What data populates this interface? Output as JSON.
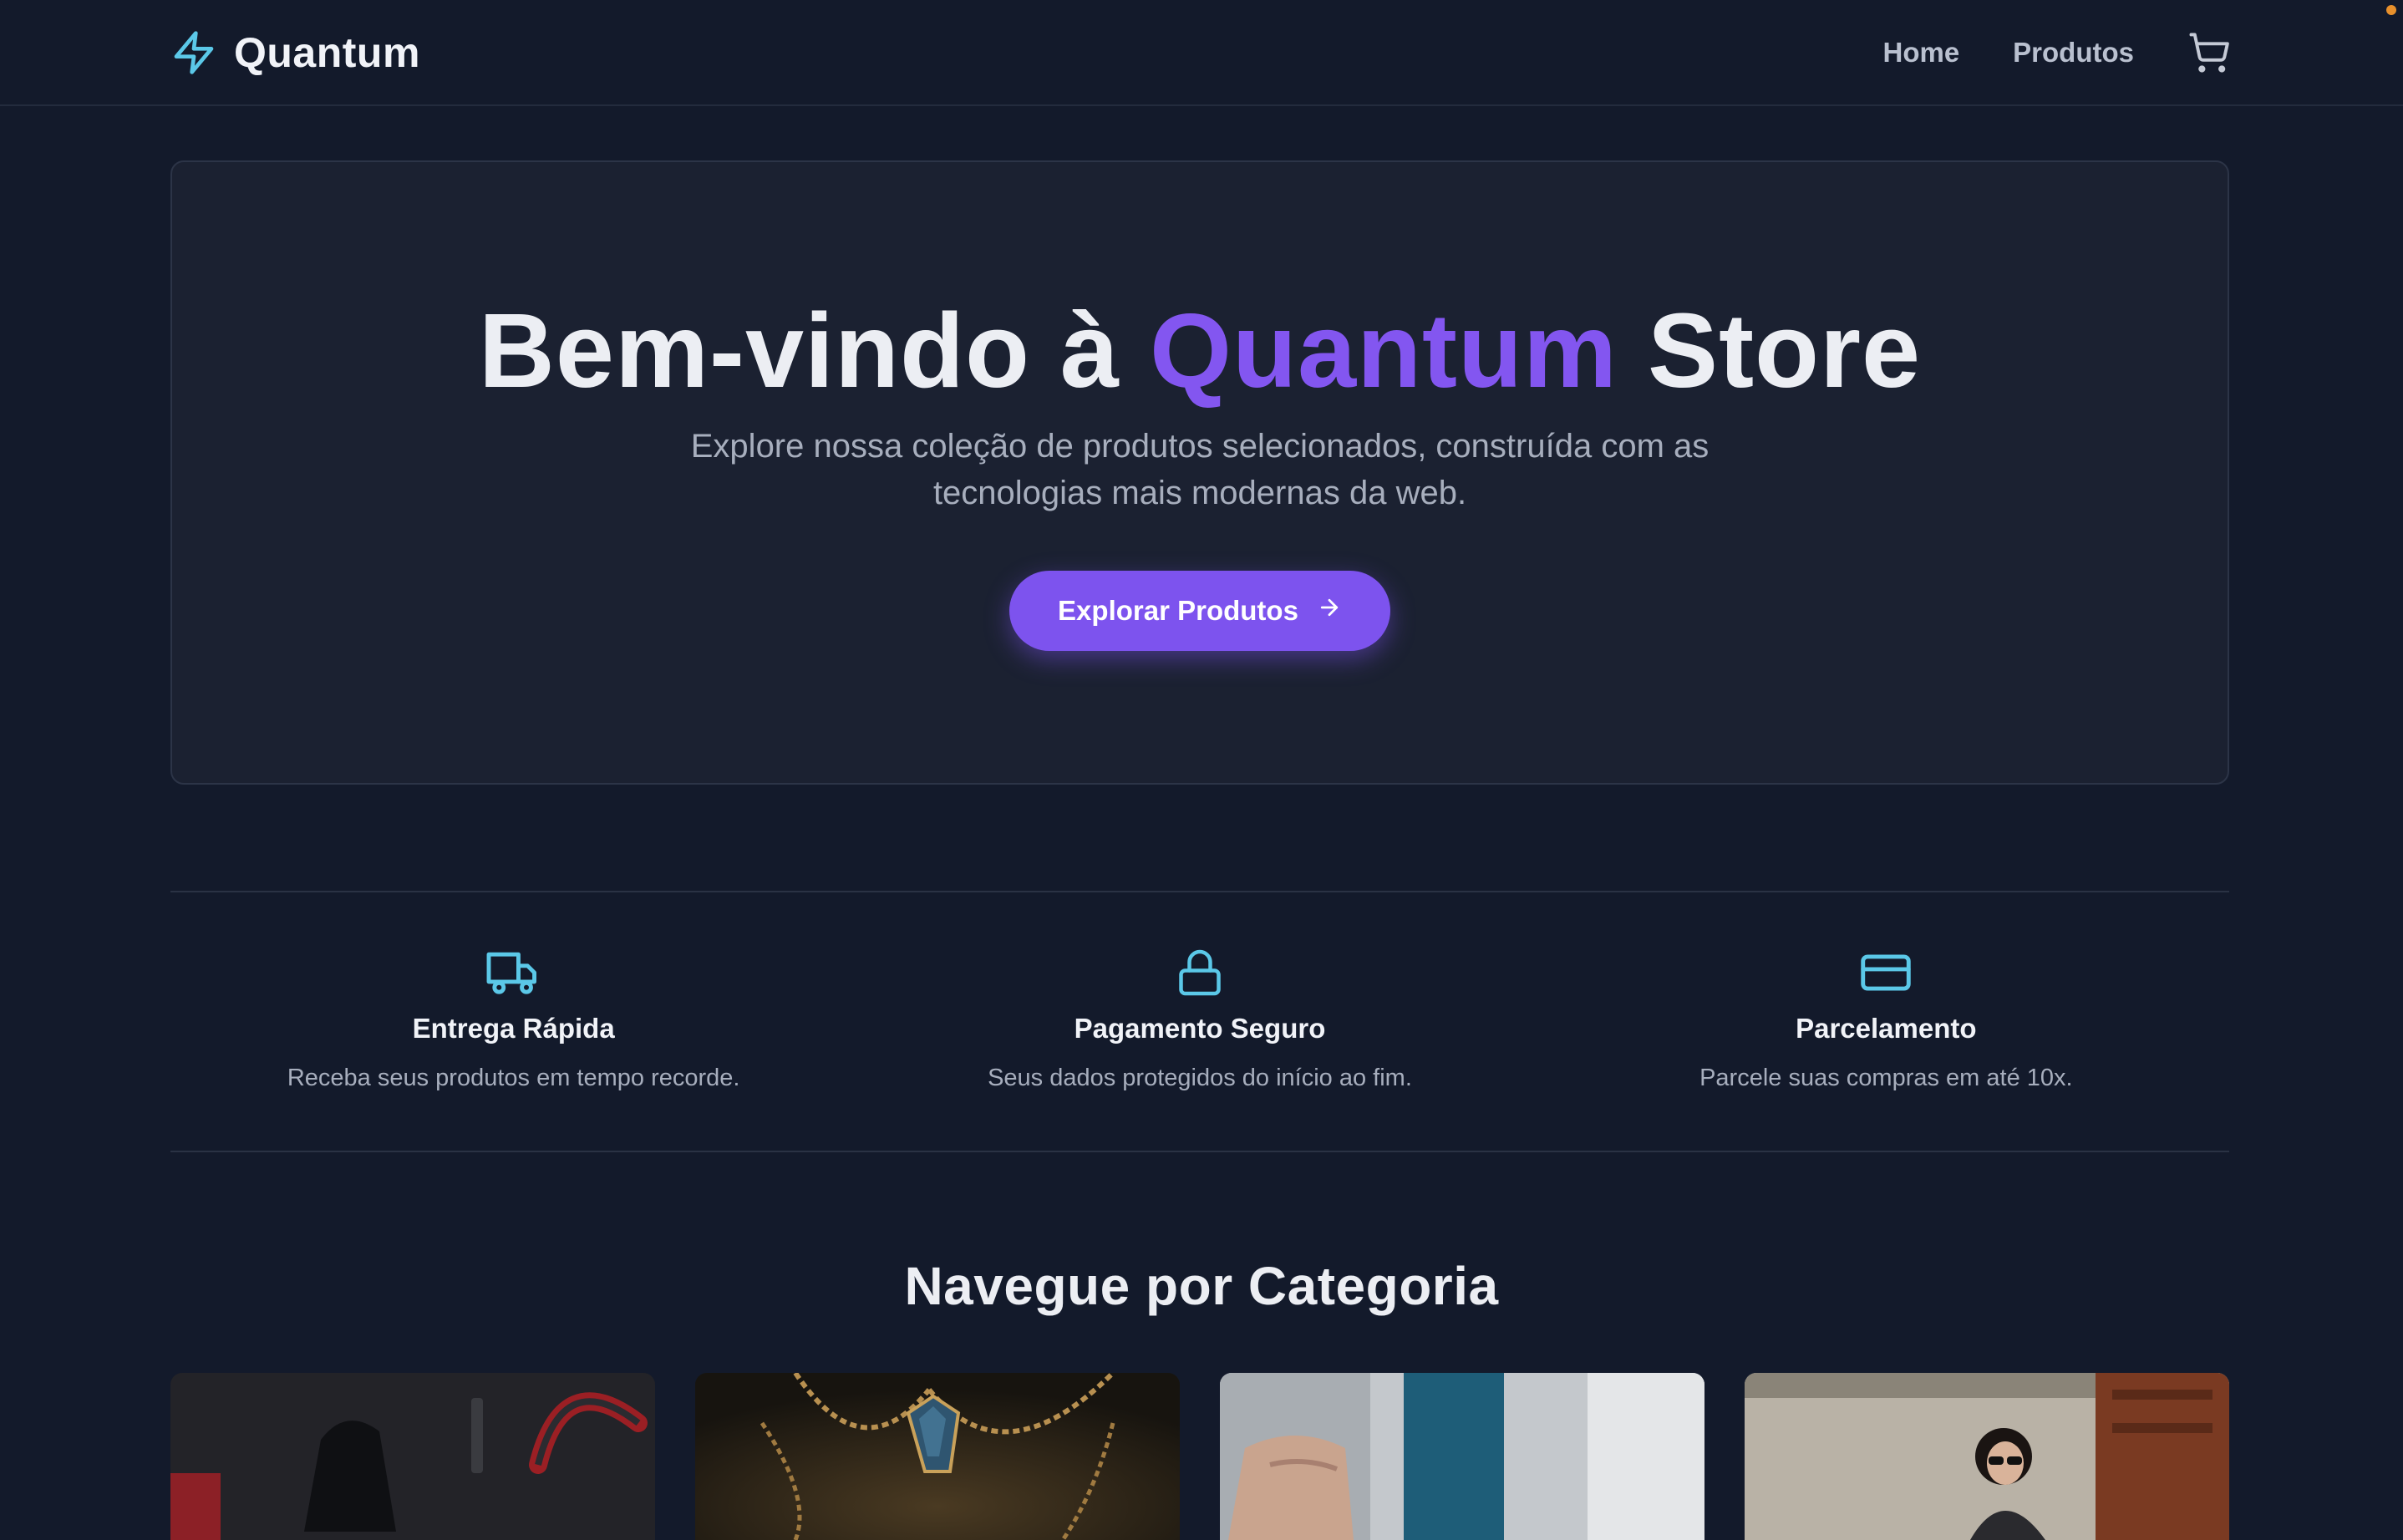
{
  "nav": {
    "brand": "Quantum",
    "links": [
      "Home",
      "Produtos"
    ],
    "cart_icon": "shopping-cart-icon",
    "brand_icon": "lightning-bolt-icon"
  },
  "hero": {
    "title_start": "Bem-vindo à ",
    "title_accent": "Quantum",
    "title_end": " Store",
    "subtitle_line1": "Explore nossa coleção de produtos selecionados, construída com as",
    "subtitle_line2": "tecnologias mais modernas da web.",
    "cta_label": "Explorar Produtos",
    "cta_icon": "arrow-right-icon"
  },
  "features": [
    {
      "icon": "truck-icon",
      "title": "Entrega Rápida",
      "desc": "Receba seus produtos em tempo recorde."
    },
    {
      "icon": "lock-icon",
      "title": "Pagamento Seguro",
      "desc": "Seus dados protegidos do início ao fim."
    },
    {
      "icon": "credit-card-icon",
      "title": "Parcelamento",
      "desc": "Parcele suas compras em até 10x."
    }
  ],
  "categories": {
    "title": "Navegue por Categoria"
  },
  "colors": {
    "background": "#131a2b",
    "accent": "#7d53ee",
    "icon_cyan": "#5bc8e8"
  }
}
